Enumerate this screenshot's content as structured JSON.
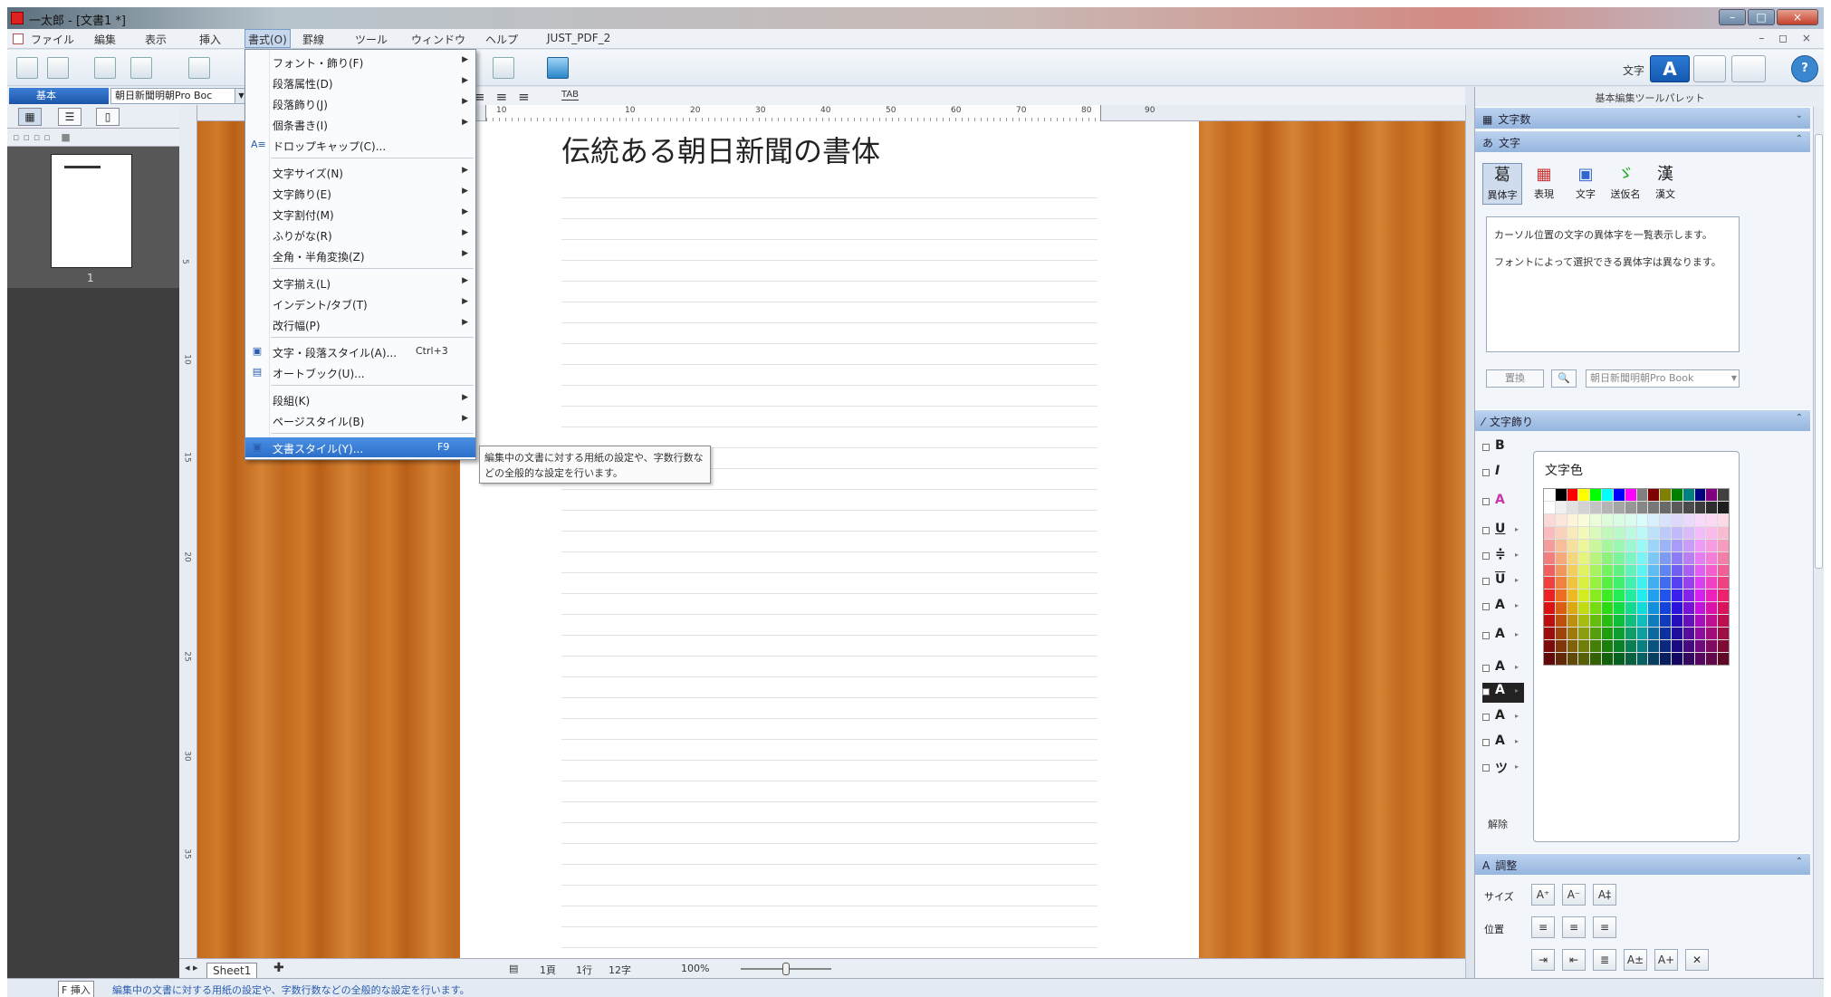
{
  "window": {
    "title": "一太郎 - [文書1 *]",
    "controls": {
      "minimize": "–",
      "maximize": "□",
      "close": "×"
    },
    "mdi_controls": "– ◻ ×"
  },
  "menubar": {
    "items": [
      "ファイル",
      "編集",
      "表示",
      "挿入",
      "書式(O)",
      "罫線",
      "ツール",
      "ウィンドウ",
      "ヘルプ",
      "JUST_PDF_2"
    ],
    "active_index": 4
  },
  "toolbar": {
    "mode_label": "文字",
    "mode_a": "A",
    "help": "?"
  },
  "formatbar": {
    "style": "基本",
    "font": "朝日新聞明朝Pro Boc",
    "tab_label": "TAB"
  },
  "format_menu": {
    "items": [
      {
        "label": "フォント・飾り(F)",
        "submenu": true
      },
      {
        "label": "段落属性(D)",
        "submenu": true
      },
      {
        "label": "段落飾り(J)",
        "submenu": true
      },
      {
        "label": "個条書き(I)",
        "submenu": true
      },
      {
        "label": "ドロップキャップ(C)...",
        "submenu": false,
        "icon": "A≡"
      },
      {
        "label": "文字サイズ(N)",
        "submenu": true
      },
      {
        "label": "文字飾り(E)",
        "submenu": true
      },
      {
        "label": "文字割付(M)",
        "submenu": true
      },
      {
        "label": "ふりがな(R)",
        "submenu": true
      },
      {
        "label": "全角・半角変換(Z)",
        "submenu": true
      },
      {
        "label": "文字揃え(L)",
        "submenu": true
      },
      {
        "label": "インデント/タブ(T)",
        "submenu": true
      },
      {
        "label": "改行幅(P)",
        "submenu": true
      },
      {
        "label": "文字・段落スタイル(A)...",
        "submenu": false,
        "shortcut": "Ctrl+3"
      },
      {
        "label": "オートブック(U)...",
        "submenu": false
      },
      {
        "label": "段組(K)",
        "submenu": true
      },
      {
        "label": "ページスタイル(B)",
        "submenu": true
      },
      {
        "label": "文書スタイル(Y)...",
        "submenu": false,
        "shortcut": "F9",
        "highlighted": true
      }
    ],
    "tooltip": "編集中の文書に対する用紙の設定や、字数行数などの全般的な設定を行います。"
  },
  "thumbnails": {
    "page_number": "1"
  },
  "ruler": {
    "h_ticks": [
      "10",
      "10",
      "20",
      "30",
      "40",
      "50",
      "60",
      "70",
      "80",
      "90"
    ],
    "v_ticks": [
      "5",
      "10",
      "15",
      "20",
      "25",
      "30",
      "35"
    ]
  },
  "document": {
    "title": "伝統ある朝日新聞の書体"
  },
  "statusbar": {
    "sheet": "Sheet1",
    "page": "1頁",
    "line": "1行",
    "col": "12字",
    "zoom": "100%",
    "mode": "F 挿入",
    "message": "編集中の文書に対する用紙の設定や、字数行数などの全般的な設定を行います。"
  },
  "palette": {
    "header": "基本編集ツールパレット",
    "sections": {
      "char_count": "文字数",
      "char": "文字",
      "char_deco": "文字飾り",
      "adjust": "調整"
    },
    "char_types": [
      {
        "glyph": "葛",
        "label": "異体字"
      },
      {
        "glyph": "▦",
        "label": "表現"
      },
      {
        "glyph": "▣",
        "label": "文字"
      },
      {
        "glyph": "ゞ",
        "label": "送仮名"
      },
      {
        "glyph": "漢",
        "label": "漢文"
      }
    ],
    "description": [
      "カーソル位置の文字の異体字を一覧表示します。",
      "フォントによって選択できる異体字は異なります。"
    ],
    "replace_button": "置換",
    "font_select": "朝日新聞明朝Pro Book",
    "color_title": "文字色",
    "deco_icons": [
      "B",
      "I",
      "A",
      "U",
      "≑",
      "U",
      "A",
      "A",
      "A",
      "A",
      "A",
      "A",
      "ツ"
    ],
    "release": "解除",
    "size_label": "サイズ",
    "position_label": "位置"
  },
  "colors": {
    "accent": "#2c6fcb",
    "wood": "#c46a1e",
    "selection_section": "#95b5de"
  }
}
